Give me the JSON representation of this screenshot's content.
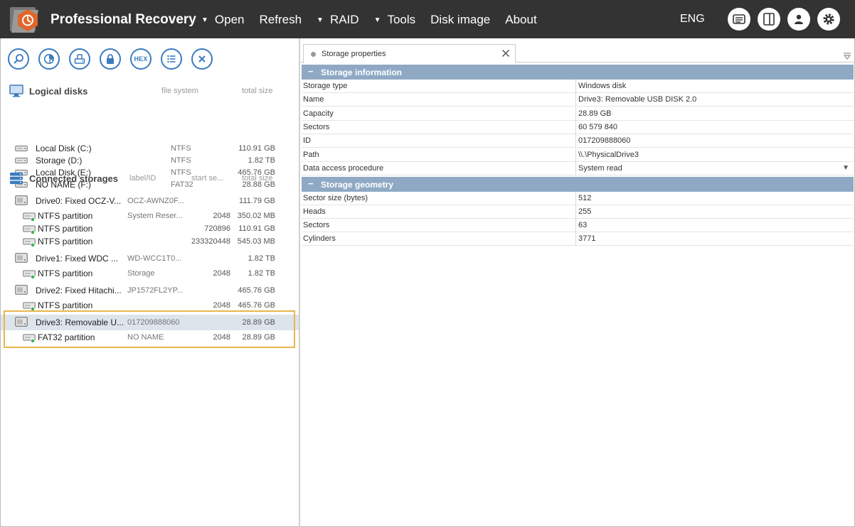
{
  "app": {
    "title": "Professional Recovery"
  },
  "menu": [
    {
      "label": "Open",
      "has_caret": true
    },
    {
      "label": "Refresh",
      "has_caret": false
    },
    {
      "label": "RAID",
      "has_caret": true
    },
    {
      "label": "Tools",
      "has_caret": true
    },
    {
      "label": "Disk image",
      "has_caret": false
    },
    {
      "label": "About",
      "has_caret": false
    }
  ],
  "language": "ENG",
  "toolbar": {
    "hex_label": "HEX"
  },
  "logical_disks": {
    "title": "Logical disks",
    "col_fs": "file system",
    "col_size": "total size",
    "items": [
      {
        "name": "Local Disk (C:)",
        "fs": "NTFS",
        "size": "110.91 GB"
      },
      {
        "name": "Storage (D:)",
        "fs": "NTFS",
        "size": "1.82 TB"
      },
      {
        "name": "Local Disk (E:)",
        "fs": "NTFS",
        "size": "465.76 GB"
      },
      {
        "name": "NO NAME (F:)",
        "fs": "FAT32",
        "size": "28.88 GB"
      }
    ]
  },
  "connected": {
    "title": "Connected storages",
    "col_label": "label/ID",
    "col_start": "start se...",
    "col_size": "total size",
    "rows": [
      {
        "kind": "drive",
        "name": "Drive0: Fixed OCZ-V...",
        "label": "OCZ-AWNZ0F...",
        "start": "",
        "size": "111.79 GB"
      },
      {
        "kind": "part",
        "name": "NTFS partition",
        "label": "System Reser...",
        "start": "2048",
        "size": "350.02 MB"
      },
      {
        "kind": "part",
        "name": "NTFS partition",
        "label": "",
        "start": "720896",
        "size": "110.91 GB"
      },
      {
        "kind": "part",
        "name": "NTFS partition",
        "label": "",
        "start": "233320448",
        "size": "545.03 MB"
      },
      {
        "kind": "drive",
        "name": "Drive1: Fixed WDC ...",
        "label": "WD-WCC1T0...",
        "start": "",
        "size": "1.82 TB"
      },
      {
        "kind": "part",
        "name": "NTFS partition",
        "label": "Storage",
        "start": "2048",
        "size": "1.82 TB"
      },
      {
        "kind": "drive",
        "name": "Drive2: Fixed Hitachi...",
        "label": "JP1572FL2YP...",
        "start": "",
        "size": "465.76 GB"
      },
      {
        "kind": "part",
        "name": "NTFS partition",
        "label": "",
        "start": "2048",
        "size": "465.76 GB"
      },
      {
        "kind": "drive",
        "name": "Drive3: Removable U...",
        "label": "017209888060",
        "start": "",
        "size": "28.89 GB",
        "selected": true
      },
      {
        "kind": "part",
        "name": "FAT32 partition",
        "label": "NO NAME",
        "start": "2048",
        "size": "28.89 GB"
      }
    ]
  },
  "tab": {
    "label": "Storage properties"
  },
  "storage_information": {
    "title": "Storage information",
    "rows": [
      {
        "key": "Storage type",
        "value": "Windows disk"
      },
      {
        "key": "Name",
        "value": "Drive3: Removable USB DISK 2.0"
      },
      {
        "key": "Capacity",
        "value": "28.89 GB"
      },
      {
        "key": "Sectors",
        "value": "60 579 840"
      },
      {
        "key": "ID",
        "value": "017209888060"
      },
      {
        "key": "Path",
        "value": "\\\\.\\PhysicalDrive3"
      },
      {
        "key": "Data access procedure",
        "value": "System read",
        "dropdown": true
      }
    ]
  },
  "storage_geometry": {
    "title": "Storage geometry",
    "rows": [
      {
        "key": "Sector size (bytes)",
        "value": "512"
      },
      {
        "key": "Heads",
        "value": "255"
      },
      {
        "key": "Sectors",
        "value": "63"
      },
      {
        "key": "Cylinders",
        "value": "3771"
      }
    ]
  },
  "colors": {
    "topbar": "#333333",
    "accent_blue": "#3b7bbf",
    "group_header": "#8fa9c5",
    "selection": "#dde4ec",
    "highlight": "#e8b54b",
    "logo_orange": "#e0662a"
  }
}
